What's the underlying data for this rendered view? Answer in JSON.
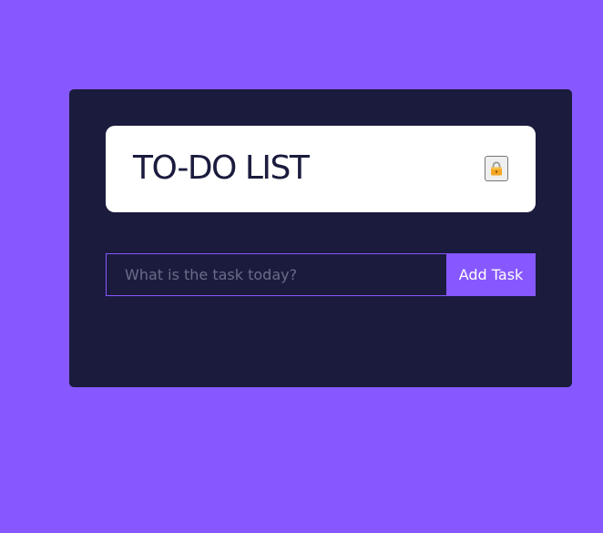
{
  "header": {
    "title": "TO-DO LIST",
    "lock_icon": "lock-icon"
  },
  "form": {
    "input_value": "",
    "input_placeholder": "What is the task today?",
    "add_label": "Add Task"
  },
  "colors": {
    "background": "#8758ff",
    "panel": "#1b1b3e",
    "card": "#ffffff",
    "accent": "#8758ff",
    "title_text": "#1b1b3e",
    "placeholder_text": "#6b6b89"
  }
}
